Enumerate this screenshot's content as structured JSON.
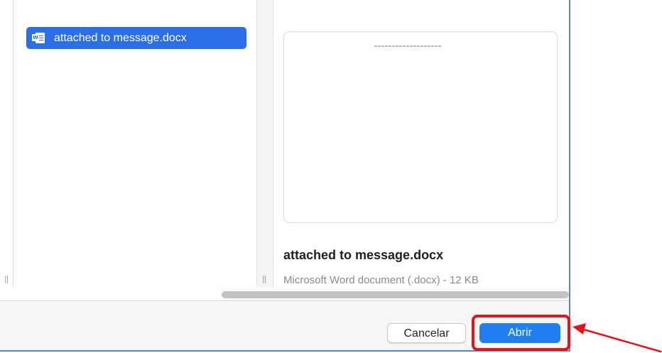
{
  "file_list": {
    "items": [
      {
        "label": "attached to message.docx",
        "icon": "word-document-icon",
        "selected": true
      }
    ]
  },
  "preview": {
    "file_name": "attached to message.docx",
    "file_info": "Microsoft Word document (.docx) - 12 KB"
  },
  "buttons": {
    "cancel_label": "Cancelar",
    "open_label": "Abrir"
  },
  "colors": {
    "selection": "#2b6ee6",
    "primary_button": "#1f7ef0",
    "annotation": "#e0141b",
    "dialog_border": "#5b86c4"
  }
}
